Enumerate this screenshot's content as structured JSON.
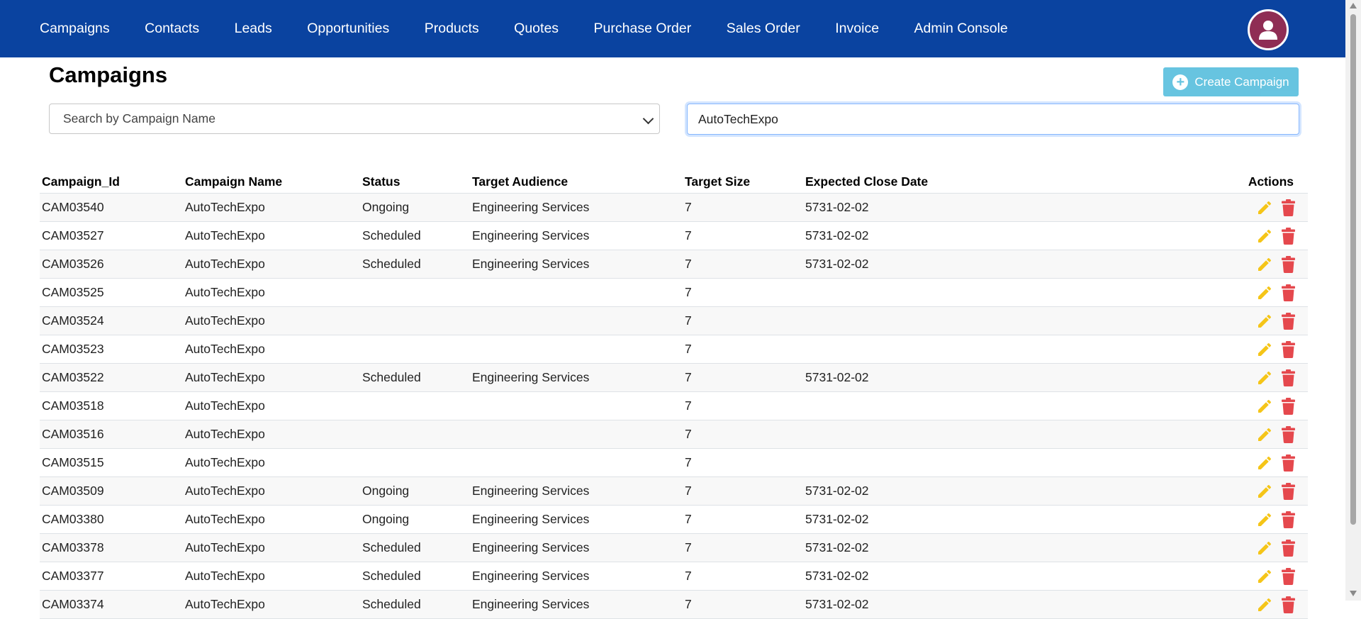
{
  "nav": {
    "items": [
      "Campaigns",
      "Contacts",
      "Leads",
      "Opportunities",
      "Products",
      "Quotes",
      "Purchase Order",
      "Sales Order",
      "Invoice",
      "Admin Console"
    ]
  },
  "page": {
    "title": "Campaigns",
    "create_button": "Create Campaign"
  },
  "filter": {
    "select_value": "Search by Campaign Name",
    "search_value": "AutoTechExpo"
  },
  "table": {
    "headers": [
      "Campaign_Id",
      "Campaign Name",
      "Status",
      "Target Audience",
      "Target Size",
      "Expected Close Date",
      "Actions"
    ],
    "rows": [
      [
        "CAM03540",
        "AutoTechExpo",
        "Ongoing",
        "Engineering Services",
        "7",
        "5731-02-02"
      ],
      [
        "CAM03527",
        "AutoTechExpo",
        "Scheduled",
        "Engineering Services",
        "7",
        "5731-02-02"
      ],
      [
        "CAM03526",
        "AutoTechExpo",
        "Scheduled",
        "Engineering Services",
        "7",
        "5731-02-02"
      ],
      [
        "CAM03525",
        "AutoTechExpo",
        "",
        "",
        "7",
        ""
      ],
      [
        "CAM03524",
        "AutoTechExpo",
        "",
        "",
        "7",
        ""
      ],
      [
        "CAM03523",
        "AutoTechExpo",
        "",
        "",
        "7",
        ""
      ],
      [
        "CAM03522",
        "AutoTechExpo",
        "Scheduled",
        "Engineering Services",
        "7",
        "5731-02-02"
      ],
      [
        "CAM03518",
        "AutoTechExpo",
        "",
        "",
        "7",
        ""
      ],
      [
        "CAM03516",
        "AutoTechExpo",
        "",
        "",
        "7",
        ""
      ],
      [
        "CAM03515",
        "AutoTechExpo",
        "",
        "",
        "7",
        ""
      ],
      [
        "CAM03509",
        "AutoTechExpo",
        "Ongoing",
        "Engineering Services",
        "7",
        "5731-02-02"
      ],
      [
        "CAM03380",
        "AutoTechExpo",
        "Ongoing",
        "Engineering Services",
        "7",
        "5731-02-02"
      ],
      [
        "CAM03378",
        "AutoTechExpo",
        "Scheduled",
        "Engineering Services",
        "7",
        "5731-02-02"
      ],
      [
        "CAM03377",
        "AutoTechExpo",
        "Scheduled",
        "Engineering Services",
        "7",
        "5731-02-02"
      ],
      [
        "CAM03374",
        "AutoTechExpo",
        "Scheduled",
        "Engineering Services",
        "7",
        "5731-02-02"
      ]
    ]
  },
  "colors": {
    "nav_bg": "#0a43a0",
    "avatar_bg": "#8f2d54",
    "create_button_bg": "#5bc0de",
    "edit_icon": "#f5c518",
    "delete_icon": "#e5484d"
  },
  "icons": {
    "avatar": "user-icon",
    "create": "plus-circle-icon",
    "edit": "pencil-icon",
    "delete": "trash-icon"
  }
}
